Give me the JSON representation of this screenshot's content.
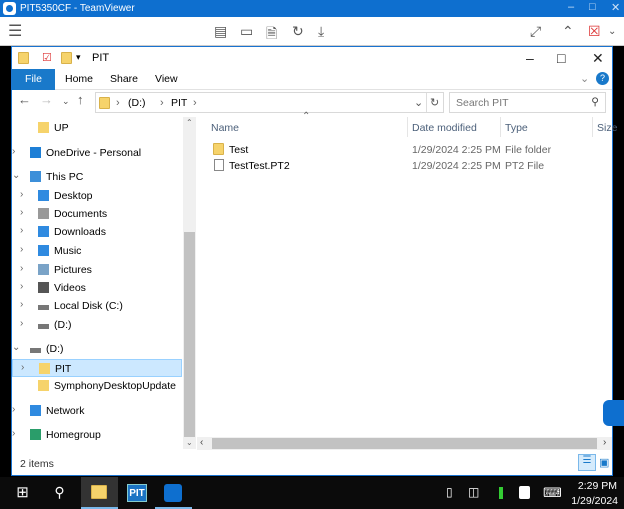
{
  "teamviewer": {
    "title": "PIT5350CF - TeamViewer"
  },
  "explorer": {
    "title": "PIT",
    "ribbon_tabs": [
      "File",
      "Home",
      "Share",
      "View"
    ],
    "address": {
      "crumbs": [
        "(D:)",
        "PIT"
      ]
    },
    "search": {
      "placeholder": "Search PIT"
    },
    "nav_items": [
      {
        "label": "UP",
        "icon": "folder-icon"
      },
      {
        "label": "OneDrive - Personal",
        "icon": "cloud-icon"
      },
      {
        "label": "This PC",
        "icon": "computer-icon"
      },
      {
        "label": "Desktop",
        "icon": "desktop-icon"
      },
      {
        "label": "Documents",
        "icon": "documents-icon"
      },
      {
        "label": "Downloads",
        "icon": "download-icon"
      },
      {
        "label": "Music",
        "icon": "music-icon"
      },
      {
        "label": "Pictures",
        "icon": "pictures-icon"
      },
      {
        "label": "Videos",
        "icon": "videos-icon"
      },
      {
        "label": "Local Disk (C:)",
        "icon": "drive-icon"
      },
      {
        "label": "(D:)",
        "icon": "drive-icon"
      },
      {
        "label": "(D:)",
        "icon": "drive-icon"
      },
      {
        "label": "PIT",
        "icon": "folder-icon"
      },
      {
        "label": "SymphonyDesktopUpdate",
        "icon": "folder-icon"
      },
      {
        "label": "Network",
        "icon": "network-icon"
      },
      {
        "label": "Homegroup",
        "icon": "homegroup-icon"
      }
    ],
    "columns": [
      "Name",
      "Date modified",
      "Type",
      "Size"
    ],
    "files": [
      {
        "name": "Test",
        "date": "1/29/2024 2:25 PM",
        "type": "File folder"
      },
      {
        "name": "TestTest.PT2",
        "date": "1/29/2024 2:25 PM",
        "type": "PT2 File"
      }
    ],
    "status": "2 items"
  },
  "taskbar": {
    "pit_label": "PIT",
    "time": "2:29 PM",
    "date": "1/29/2024"
  }
}
